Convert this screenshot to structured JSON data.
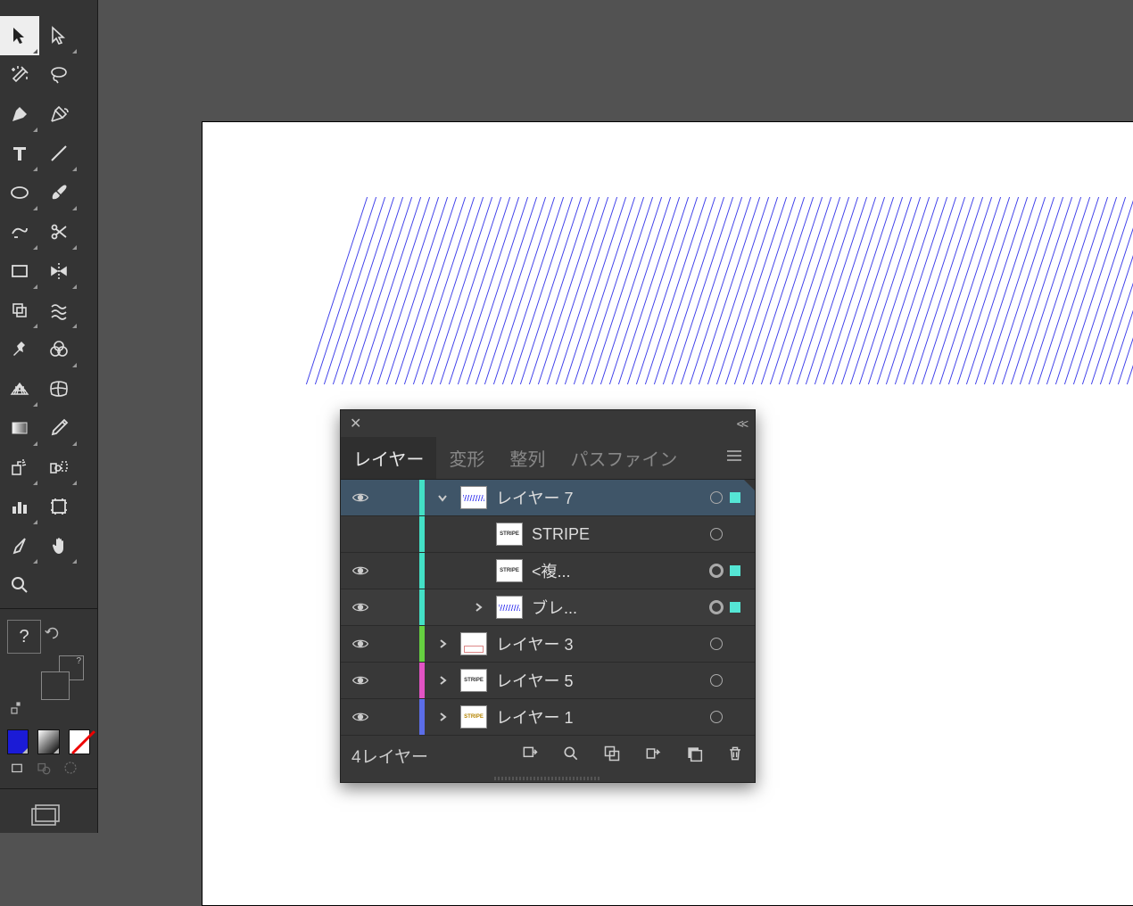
{
  "panel": {
    "tabs": [
      "レイヤー",
      "変形",
      "整列",
      "パスファイン"
    ],
    "active_tab": 0,
    "footer_label": "4レイヤー"
  },
  "layers": [
    {
      "name": "レイヤー 7",
      "color": "cb-cyan",
      "visible": true,
      "expanded": true,
      "depth": 0,
      "selected": true,
      "target": "ring",
      "selbox": true,
      "thumb": "th-stripe",
      "has_fold": true
    },
    {
      "name": "STRIPE",
      "color": "cb-cyan",
      "visible": false,
      "expanded": null,
      "depth": 1,
      "selected": false,
      "target": "ring",
      "selbox": false,
      "thumb": "text",
      "thumb_text": "STRIPE"
    },
    {
      "name": "<複...",
      "color": "cb-cyan",
      "visible": true,
      "expanded": null,
      "depth": 1,
      "selected": false,
      "target": "tgt",
      "selbox": true,
      "thumb": "text",
      "thumb_text": "STRIPE"
    },
    {
      "name": "ブレ...",
      "color": "cb-cyan",
      "visible": true,
      "expanded": false,
      "depth": 1,
      "selected": false,
      "subsel": true,
      "target": "tgt",
      "selbox": true,
      "thumb": "th-stripe"
    },
    {
      "name": "レイヤー 3",
      "color": "cb-green",
      "visible": true,
      "expanded": false,
      "depth": 0,
      "selected": false,
      "target": "ring",
      "selbox": false,
      "thumb": "th-box"
    },
    {
      "name": "レイヤー 5",
      "color": "cb-pink",
      "visible": true,
      "expanded": false,
      "depth": 0,
      "selected": false,
      "target": "ring",
      "selbox": false,
      "thumb": "text",
      "thumb_text": "STRIPE"
    },
    {
      "name": "レイヤー 1",
      "color": "cb-blue",
      "visible": true,
      "expanded": false,
      "depth": 0,
      "selected": false,
      "target": "ring",
      "selbox": false,
      "thumb": "th-gold",
      "thumb_text": "STRIPE"
    }
  ],
  "tools": {
    "help": "?"
  }
}
